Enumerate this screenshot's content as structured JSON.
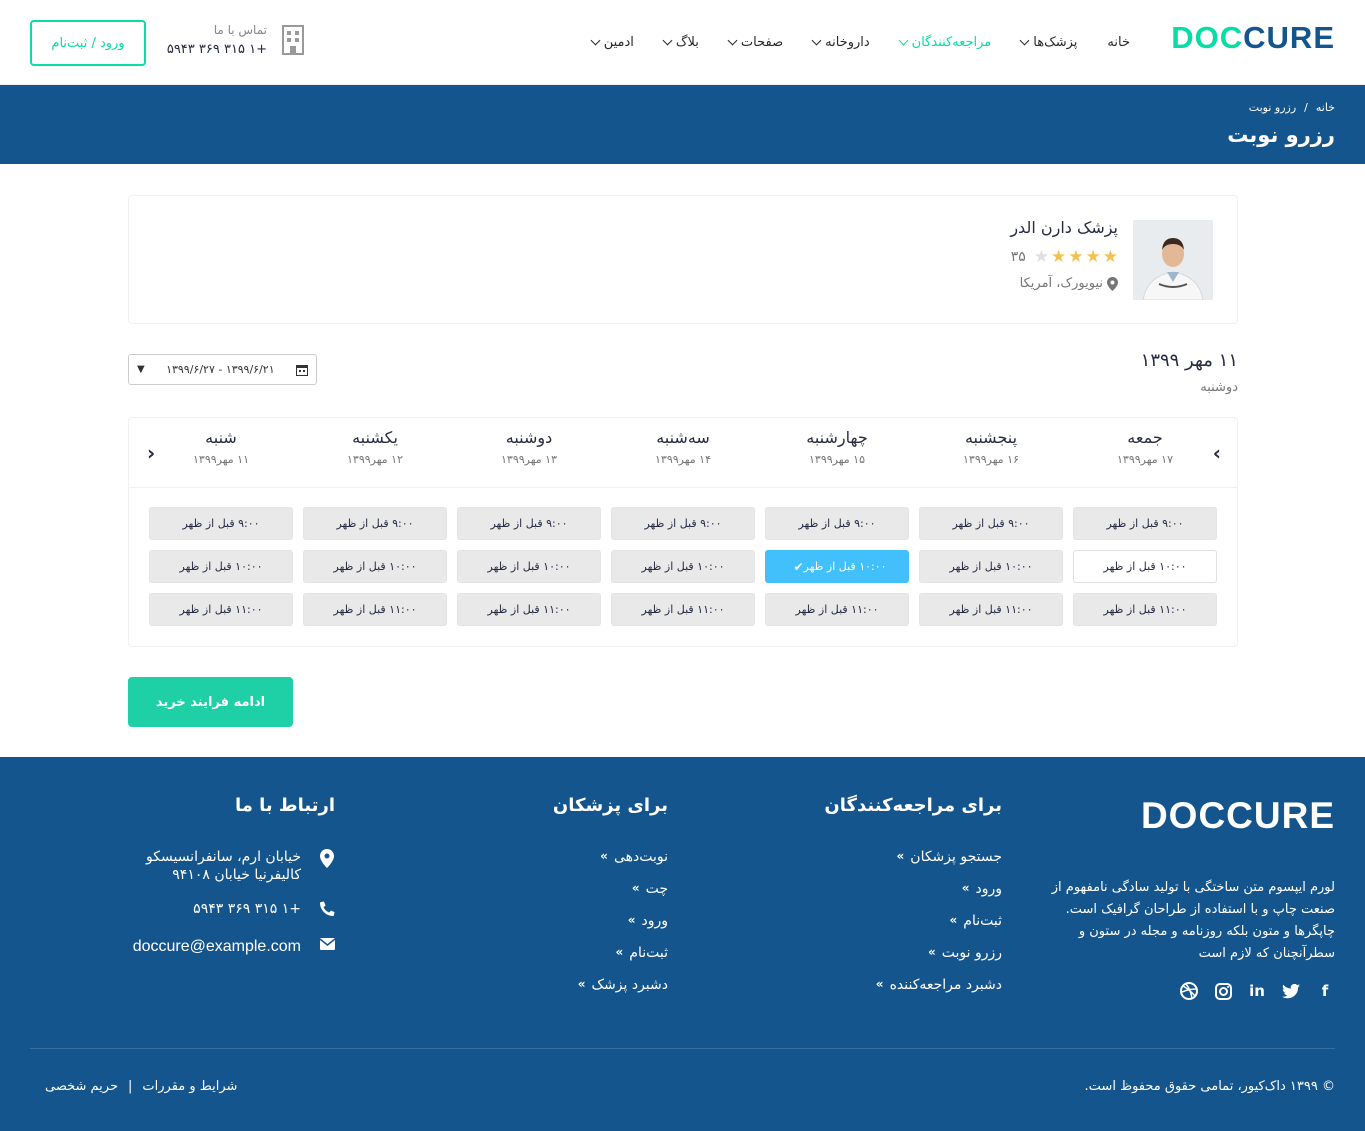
{
  "header": {
    "logo_a": "DOC",
    "logo_b": "CURE",
    "nav": [
      {
        "label": "خانه",
        "has_dropdown": false,
        "active": false
      },
      {
        "label": "پزشک‌ها",
        "has_dropdown": true,
        "active": false
      },
      {
        "label": "مراجعه‌کنندگان",
        "has_dropdown": true,
        "active": true
      },
      {
        "label": "داروخانه",
        "has_dropdown": true,
        "active": false
      },
      {
        "label": "صفحات",
        "has_dropdown": true,
        "active": false
      },
      {
        "label": "بلاگ",
        "has_dropdown": true,
        "active": false
      },
      {
        "label": "ادمین",
        "has_dropdown": true,
        "active": false
      }
    ],
    "contact_label": "تماس با ما",
    "contact_phone": "+۱ ۳۱۵ ۳۶۹ ۵۹۴۳",
    "login_label": "ورود / ثبت‌نام"
  },
  "breadcrumb": {
    "home": "خانه",
    "separator": "/",
    "current": "رزرو نوبت",
    "title": "رزرو نوبت"
  },
  "doctor": {
    "name": "پزشک دارن الدر",
    "rating": 4,
    "max_rating": 5,
    "rating_count": "۳۵",
    "location": "نیویورک، آمریکا"
  },
  "booking": {
    "date_main": "۱۱ مهر ۱۳۹۹",
    "date_sub": "دوشنبه",
    "range": "۱۳۹۹/۶/۲۱ - ۱۳۹۹/۶/۲۷",
    "days": [
      {
        "name": "جمعه",
        "date": "۱۷ مهر۱۳۹۹"
      },
      {
        "name": "پنجشنبه",
        "date": "۱۶ مهر۱۳۹۹"
      },
      {
        "name": "چهارشنبه",
        "date": "۱۵ مهر۱۳۹۹"
      },
      {
        "name": "سه‌شنبه",
        "date": "۱۴ مهر۱۳۹۹"
      },
      {
        "name": "دوشنبه",
        "date": "۱۳ مهر۱۳۹۹"
      },
      {
        "name": "یکشنبه",
        "date": "۱۲ مهر۱۳۹۹"
      },
      {
        "name": "شنبه",
        "date": "۱۱ مهر۱۳۹۹"
      }
    ],
    "times": [
      "۹:۰۰ قبل از ظهر",
      "۱۰:۰۰ قبل از ظهر",
      "۱۱:۰۰ قبل از ظهر"
    ],
    "selected": {
      "day": 2,
      "time": 1
    },
    "available": {
      "day": 0,
      "time": 1
    },
    "proceed_label": "ادامه فرایند خرید"
  },
  "footer": {
    "logo": "DOCCURE",
    "about": "لورم ایپسوم متن ساختگی با تولید سادگی نامفهوم از صنعت چاپ و با استفاده از طراحان گرافیک است. چاپگرها و متون بلکه روزنامه و مجله در ستون و سطرآنچنان که لازم است",
    "patients_title": "برای مراجعه‌کنندگان",
    "patients_links": [
      "جستجو پزشکان",
      "ورود",
      "ثبت‌نام",
      "رزرو نوبت",
      "دشبرد مراجعه‌کننده"
    ],
    "doctors_title": "برای پزشکان",
    "doctors_links": [
      "نوبت‌دهی",
      "چت",
      "ورود",
      "ثبت‌نام",
      "دشبرد پزشک"
    ],
    "contact_title": "ارتباط با ما",
    "address_1": "خیابان ارم، سانفرانسیسکو",
    "address_2": "کالیفرنیا خیابان ۹۴۱۰۸",
    "phone": "+۱ ۳۱۵ ۳۶۹ ۵۹۴۳",
    "email": "doccure@example.com",
    "copyright": "© ۱۳۹۹ داک‌کیور، تمامی حقوق محفوظ است.",
    "terms": "شرایط و مقررات",
    "sep": "|",
    "privacy": "حریم شخصی"
  },
  "colors": {
    "primary": "#15558d",
    "accent": "#09dca4",
    "selected_slot": "#42c0fb",
    "star": "#f4c150"
  }
}
